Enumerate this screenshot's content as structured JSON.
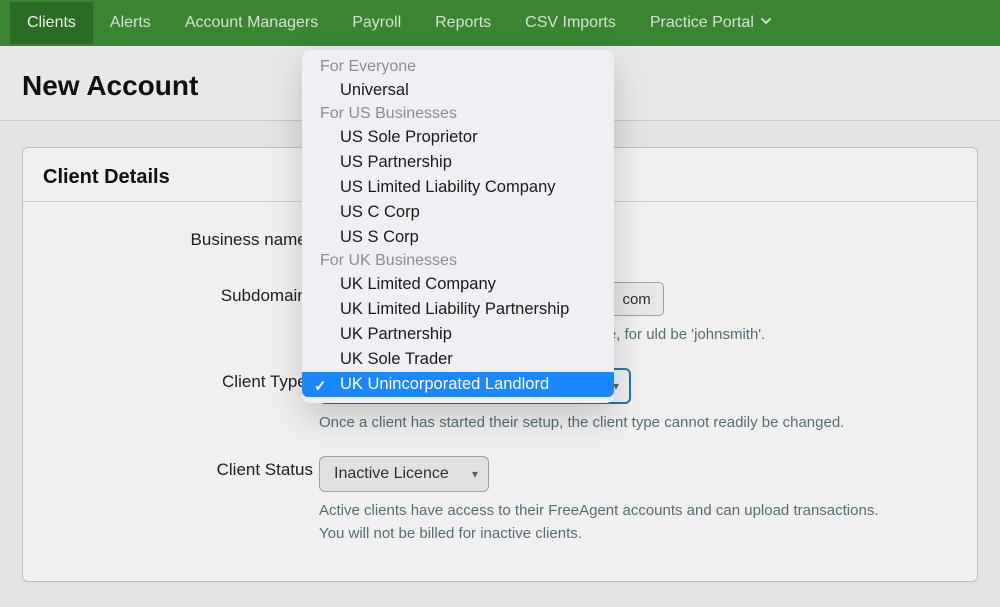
{
  "nav": {
    "items": [
      {
        "label": "Clients",
        "active": true
      },
      {
        "label": "Alerts"
      },
      {
        "label": "Account Managers"
      },
      {
        "label": "Payroll"
      },
      {
        "label": "Reports"
      },
      {
        "label": "CSV Imports"
      },
      {
        "label": "Practice Portal",
        "dropdown": true
      }
    ]
  },
  "page": {
    "title": "New Account"
  },
  "panel": {
    "title": "Client Details"
  },
  "form": {
    "business_name": {
      "label": "Business name",
      "required": true,
      "value": ""
    },
    "subdomain": {
      "label": "Subdomain",
      "required": true,
      "value": "",
      "suffix": "com",
      "help": "something derived from the business's name, for uld be 'johnsmith'."
    },
    "client_type": {
      "label": "Client Type",
      "required": true,
      "value": "UK Unincorporated Landlord",
      "help": "Once a client has started their setup, the client type cannot readily be changed."
    },
    "client_status": {
      "label": "Client Status",
      "value": "Inactive Licence",
      "help_line1": "Active clients have access to their FreeAgent accounts and can upload transactions.",
      "help_line2": "You will not be billed for inactive clients."
    }
  },
  "dropdown": {
    "groups": [
      {
        "label": "For Everyone",
        "items": [
          "Universal"
        ]
      },
      {
        "label": "For US Businesses",
        "items": [
          "US Sole Proprietor",
          "US Partnership",
          "US Limited Liability Company",
          "US C Corp",
          "US S Corp"
        ]
      },
      {
        "label": "For UK Businesses",
        "items": [
          "UK Limited Company",
          "UK Limited Liability Partnership",
          "UK Partnership",
          "UK Sole Trader",
          "UK Unincorporated Landlord"
        ]
      }
    ],
    "selected": "UK Unincorporated Landlord"
  }
}
